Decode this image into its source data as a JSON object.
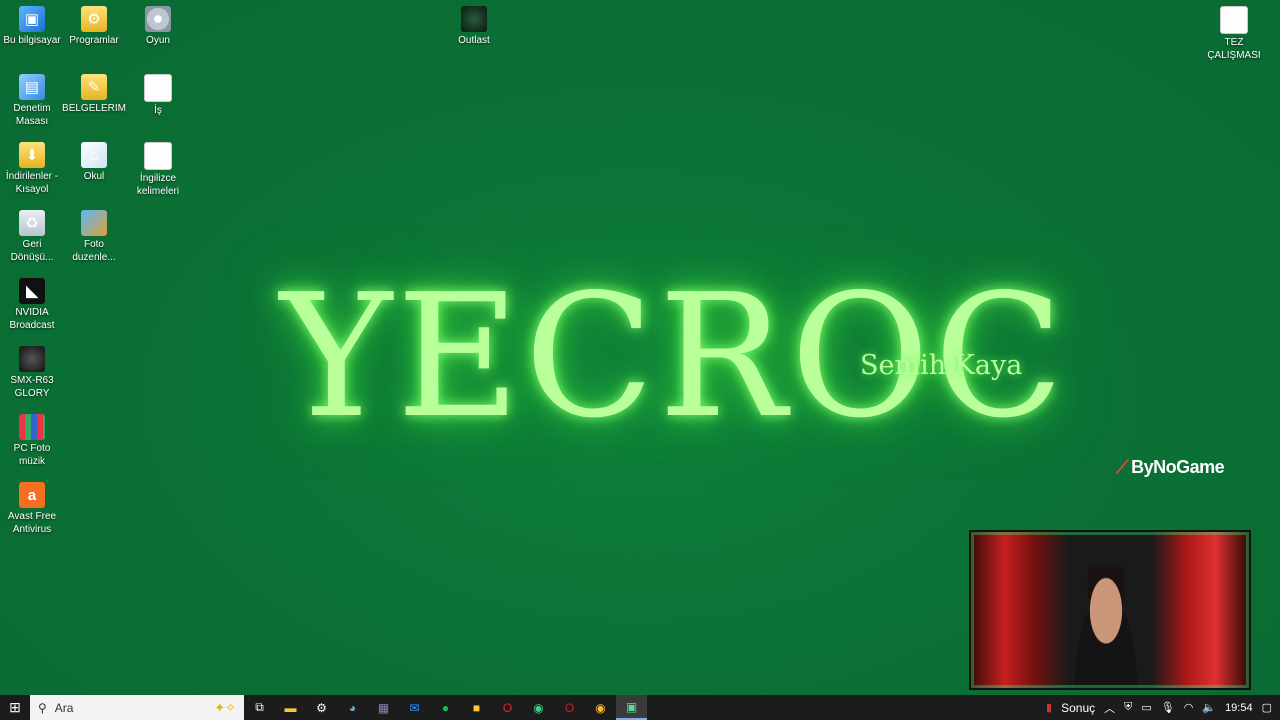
{
  "desktop_icons": [
    {
      "label": "Bu bilgisayar",
      "icon": "computer-icon"
    },
    {
      "label": "Programlar",
      "icon": "programs-folder-icon"
    },
    {
      "label": "Oyun",
      "icon": "disc-icon"
    },
    {
      "label": "Outlast",
      "icon": "outlast-game-icon"
    },
    {
      "label": "TEZ ÇALIŞMASI",
      "icon": "document-icon"
    },
    {
      "label": "Denetim Masası",
      "icon": "control-panel-icon"
    },
    {
      "label": "BELGELERIM",
      "icon": "documents-folder-icon"
    },
    {
      "label": "İş",
      "icon": "document-icon"
    },
    {
      "label": "İndirilenler - Kısayol",
      "icon": "downloads-shortcut-icon"
    },
    {
      "label": "Okul",
      "icon": "home-folder-icon"
    },
    {
      "label": "İngilizce kelimeleri",
      "icon": "document-icon"
    },
    {
      "label": "Geri Dönüşü...",
      "icon": "recycle-bin-icon"
    },
    {
      "label": "Foto duzenle...",
      "icon": "photo-editor-icon"
    },
    {
      "label": "NVIDIA Broadcast",
      "icon": "nvidia-icon"
    },
    {
      "label": "SMX-R63 GLORY",
      "icon": "mouse-icon"
    },
    {
      "label": "PC Foto müzik",
      "icon": "photo-grid-icon"
    },
    {
      "label": "Avast Free Antivirus",
      "icon": "avast-icon"
    }
  ],
  "wallpaper": {
    "logo_text": "YECROC",
    "signature": "Semih Kaya",
    "glow_color": "#b9ff9a",
    "background_color": "#0b7236"
  },
  "watermark": {
    "text": "ByNoGame"
  },
  "taskbar": {
    "search_placeholder": "Ara",
    "apps": [
      "task-view-icon",
      "file-explorer-icon",
      "settings-icon",
      "copilot-icon",
      "app-icon",
      "mail-icon",
      "spotify-icon",
      "sticky-notes-icon",
      "opera-icon",
      "chrome-icon",
      "opera-gx-icon",
      "chrome-canary-icon",
      "active-app-icon"
    ],
    "tray_label": "Sonuç",
    "clock": "19:54"
  }
}
